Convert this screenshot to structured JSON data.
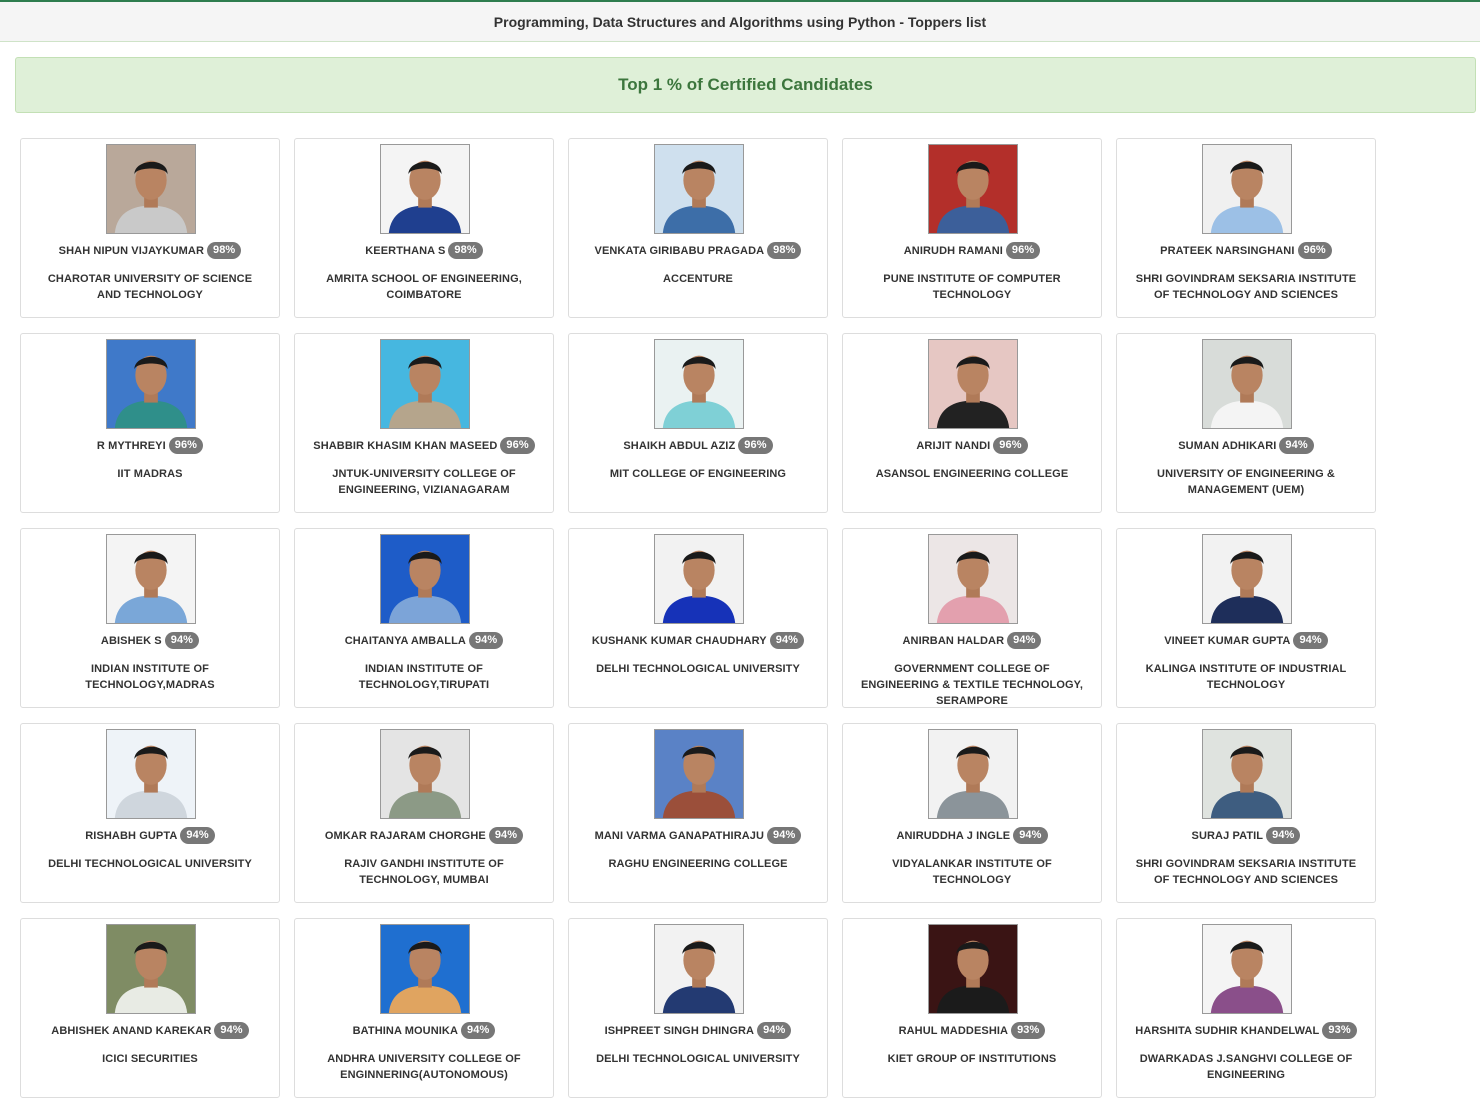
{
  "page_title": "Programming, Data Structures and Algorithms using Python - Toppers list",
  "banner_text": "Top 1 % of Certified Candidates",
  "toppers": [
    {
      "name": "SHAH NIPUN VIJAYKUMAR",
      "score": "98%",
      "institution": "CHAROTAR UNIVERSITY OF SCIENCE AND TECHNOLOGY",
      "photo_bg": "#b9a89a",
      "shirt": "#c9c9c9"
    },
    {
      "name": "KEERTHANA S",
      "score": "98%",
      "institution": "AMRITA SCHOOL OF ENGINEERING, COIMBATORE",
      "photo_bg": "#f4f4f4",
      "shirt": "#1f3f8f"
    },
    {
      "name": "VENKATA GIRIBABU PRAGADA",
      "score": "98%",
      "institution": "ACCENTURE",
      "photo_bg": "#cfe0ee",
      "shirt": "#3d6ea8"
    },
    {
      "name": "ANIRUDH RAMANI",
      "score": "96%",
      "institution": "PUNE INSTITUTE OF COMPUTER TECHNOLOGY",
      "photo_bg": "#b32f2a",
      "shirt": "#3c5f9a"
    },
    {
      "name": "PRATEEK NARSINGHANI",
      "score": "96%",
      "institution": "SHRI GOVINDRAM SEKSARIA INSTITUTE OF TECHNOLOGY AND SCIENCES",
      "photo_bg": "#f0f0f0",
      "shirt": "#9cc0e6"
    },
    {
      "name": "R MYTHREYI",
      "score": "96%",
      "institution": "IIT MADRAS",
      "photo_bg": "#3f79c9",
      "shirt": "#2f8f8a"
    },
    {
      "name": "SHABBIR KHASIM KHAN MASEED",
      "score": "96%",
      "institution": "JNTUK-UNIVERSITY COLLEGE OF ENGINEERING, VIZIANAGARAM",
      "photo_bg": "#46b7e0",
      "shirt": "#b5a58c"
    },
    {
      "name": "SHAIKH ABDUL AZIZ",
      "score": "96%",
      "institution": "MIT COLLEGE OF ENGINEERING",
      "photo_bg": "#eaf2f2",
      "shirt": "#7fd0d6"
    },
    {
      "name": "ARIJIT NANDI",
      "score": "96%",
      "institution": "ASANSOL ENGINEERING COLLEGE",
      "photo_bg": "#e6c7c3",
      "shirt": "#222222"
    },
    {
      "name": "SUMAN ADHIKARI",
      "score": "94%",
      "institution": "UNIVERSITY OF ENGINEERING & MANAGEMENT (UEM)",
      "photo_bg": "#d8dcd9",
      "shirt": "#f4f4f4"
    },
    {
      "name": "ABISHEK S",
      "score": "94%",
      "institution": "INDIAN INSTITUTE OF TECHNOLOGY,MADRAS",
      "photo_bg": "#f4f4f4",
      "shirt": "#7aa7d8"
    },
    {
      "name": "CHAITANYA AMBALLA",
      "score": "94%",
      "institution": "INDIAN INSTITUTE OF TECHNOLOGY,TIRUPATI",
      "photo_bg": "#1e5cc8",
      "shirt": "#7ca4d8"
    },
    {
      "name": "KUSHANK KUMAR CHAUDHARY",
      "score": "94%",
      "institution": "DELHI TECHNOLOGICAL UNIVERSITY",
      "photo_bg": "#f2f2f2",
      "shirt": "#1632b8"
    },
    {
      "name": "ANIRBAN HALDAR",
      "score": "94%",
      "institution": "GOVERNMENT COLLEGE OF ENGINEERING & TEXTILE TECHNOLOGY, SERAMPORE",
      "photo_bg": "#ece6e6",
      "shirt": "#e3a0ae"
    },
    {
      "name": "VINEET KUMAR GUPTA",
      "score": "94%",
      "institution": "KALINGA INSTITUTE OF INDUSTRIAL TECHNOLOGY",
      "photo_bg": "#f2f2f2",
      "shirt": "#1e2e5a"
    },
    {
      "name": "RISHABH GUPTA",
      "score": "94%",
      "institution": "DELHI TECHNOLOGICAL UNIVERSITY",
      "photo_bg": "#eef3f8",
      "shirt": "#cfd6dd"
    },
    {
      "name": "OMKAR RAJARAM CHORGHE",
      "score": "94%",
      "institution": "RAJIV GANDHI INSTITUTE OF TECHNOLOGY, MUMBAI",
      "photo_bg": "#e4e4e4",
      "shirt": "#8c9a86"
    },
    {
      "name": "MANI VARMA GANAPATHIRAJU",
      "score": "94%",
      "institution": "RAGHU ENGINEERING COLLEGE",
      "photo_bg": "#5a82c6",
      "shirt": "#9b4f3a"
    },
    {
      "name": "ANIRUDDHA J INGLE",
      "score": "94%",
      "institution": "VIDYALANKAR INSTITUTE OF TECHNOLOGY",
      "photo_bg": "#f2f2f2",
      "shirt": "#8b949a"
    },
    {
      "name": "SURAJ PATIL",
      "score": "94%",
      "institution": "SHRI GOVINDRAM SEKSARIA INSTITUTE OF TECHNOLOGY AND SCIENCES",
      "photo_bg": "#dfe3df",
      "shirt": "#3e5d80"
    },
    {
      "name": "ABHISHEK ANAND KAREKAR",
      "score": "94%",
      "institution": "ICICI SECURITIES",
      "photo_bg": "#7f8c64",
      "shirt": "#e8ebe4"
    },
    {
      "name": "BATHINA MOUNIKA",
      "score": "94%",
      "institution": "ANDHRA UNIVERSITY COLLEGE OF ENGINNERING(AUTONOMOUS)",
      "photo_bg": "#1f6fd0",
      "shirt": "#e0a460"
    },
    {
      "name": "ISHPREET SINGH DHINGRA",
      "score": "94%",
      "institution": "DELHI TECHNOLOGICAL UNIVERSITY",
      "photo_bg": "#f2f2f2",
      "shirt": "#233a72"
    },
    {
      "name": "RAHUL MADDESHIA",
      "score": "93%",
      "institution": "KIET GROUP OF INSTITUTIONS",
      "photo_bg": "#3a1414",
      "shirt": "#1b1b1b"
    },
    {
      "name": "HARSHITA SUDHIR KHANDELWAL",
      "score": "93%",
      "institution": "DWARKADAS J.SANGHVI COLLEGE OF ENGINEERING",
      "photo_bg": "#f4f4f4",
      "shirt": "#8a4f8a"
    }
  ]
}
